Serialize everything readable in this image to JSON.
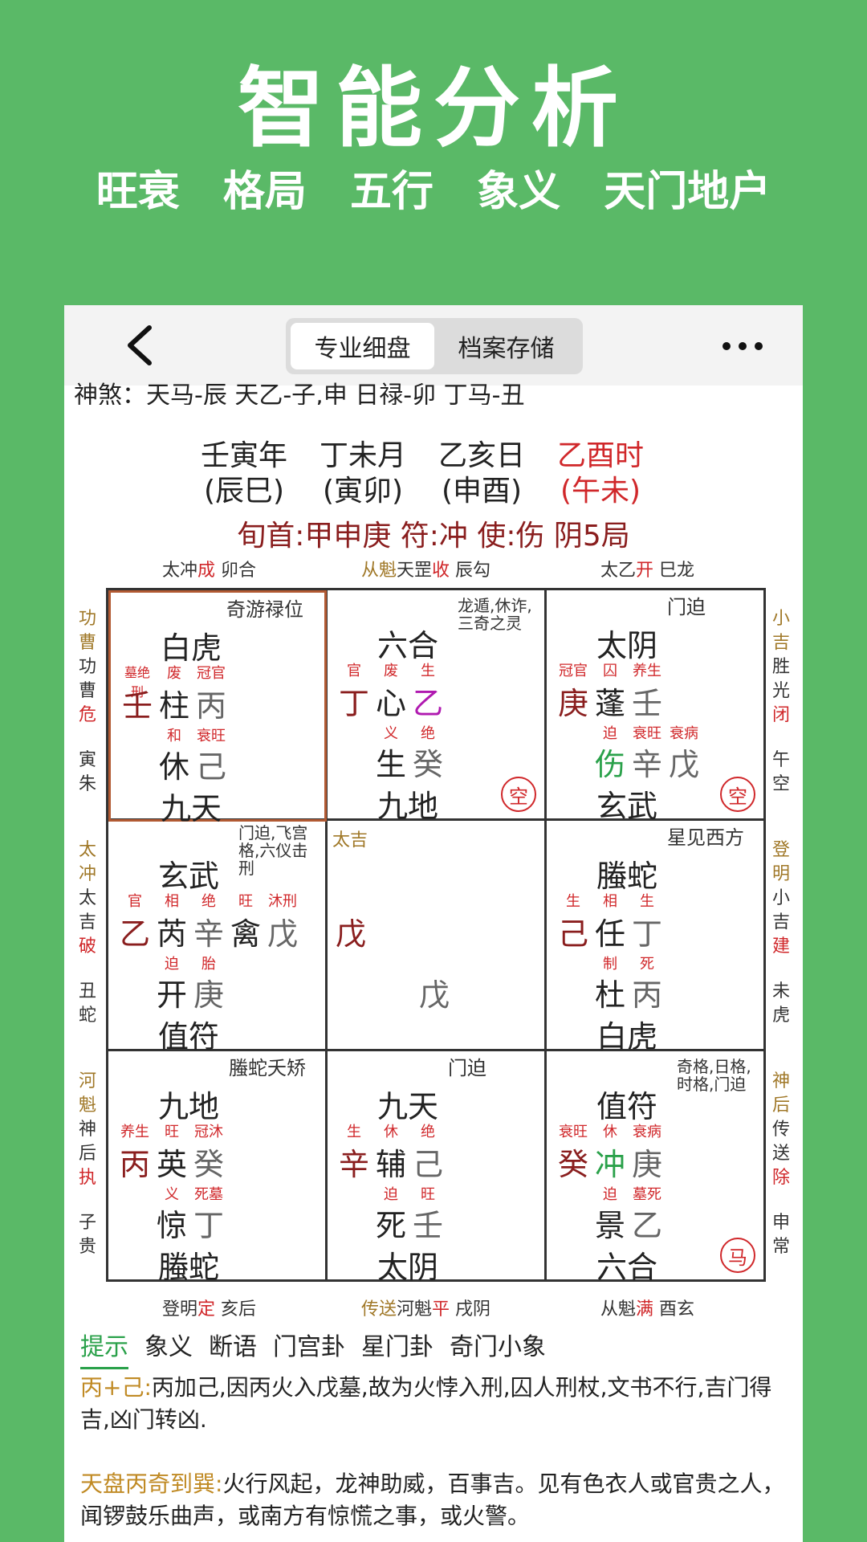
{
  "promo": {
    "title": "智能分析",
    "features": [
      "旺衰",
      "格局",
      "五行",
      "象义",
      "天门地户"
    ]
  },
  "navbar": {
    "tab_active": "专业细盘",
    "tab_other": "档案存储"
  },
  "shensha": "神煞：天马-辰 天乙-子,申 日禄-卯 丁马-丑",
  "pillars": [
    {
      "gz": "壬寅年",
      "kong": "(辰巳)"
    },
    {
      "gz": "丁未月",
      "kong": "(寅卯)"
    },
    {
      "gz": "乙亥日",
      "kong": "(申酉)"
    },
    {
      "gz": "乙酉时",
      "kong": "(午未)"
    }
  ],
  "xun": "旬首:甲申庚 符:冲 使:伤 阴5局",
  "top_edge": [
    {
      "a": "太冲",
      "b": "成",
      "c": " 卯合"
    },
    {
      "a": "从魁",
      "b": "天罡",
      "c": "收",
      "d": " 辰勾"
    },
    {
      "a": "太乙",
      "b": "开",
      "c": " 巳龙"
    }
  ],
  "bottom_edge": [
    {
      "a": "登明",
      "b": "定",
      "c": " 亥后"
    },
    {
      "a": "传送",
      "b": "河魁",
      "c": "平",
      "d": " 戌阴"
    },
    {
      "a": "从魁",
      "b": "满",
      "c": " 酉玄"
    }
  ],
  "left_side": [
    {
      "l1": "功",
      "l2": "曹",
      "l3": "功",
      "l4": "曹",
      "l5": "危",
      "l6": "寅",
      "l7": "朱"
    },
    {
      "l1": "太",
      "l2": "冲",
      "l3": "太",
      "l4": "吉",
      "l5": "破",
      "l6": "丑",
      "l7": "蛇"
    },
    {
      "l1": "河",
      "l2": "魁",
      "l3": "神",
      "l4": "后",
      "l5": "执",
      "l6": "子",
      "l7": "贵"
    }
  ],
  "right_side": [
    {
      "l1": "小",
      "l2": "吉",
      "l3": "胜",
      "l4": "光",
      "l5": "闭",
      "l6": "午",
      "l7": "空"
    },
    {
      "l1": "登",
      "l2": "明",
      "l3": "小",
      "l4": "吉",
      "l5": "建",
      "l6": "未",
      "l7": "虎"
    },
    {
      "l1": "神",
      "l2": "后",
      "l3": "传",
      "l4": "送",
      "l5": "除",
      "l6": "申",
      "l7": "常"
    }
  ],
  "palaces": {
    "p4": {
      "note": "奇游禄位",
      "god": "白虎",
      "s1": "墓绝刑",
      "s2": "废",
      "s3": "冠官",
      "c1": "壬",
      "c2": "柱",
      "c3": "丙",
      "t1": "和",
      "t2": "衰旺",
      "d1": "休",
      "d2": "己",
      "spirit": "九天"
    },
    "p9": {
      "note": "龙遁,休诈,三奇之灵",
      "god": "六合",
      "s1": "官",
      "s2": "废",
      "s3": "生",
      "c1": "丁",
      "c2": "心",
      "c3": "乙",
      "t1": "义",
      "t2": "绝",
      "d1": "生",
      "d2": "癸",
      "spirit": "九地",
      "stamp": "空"
    },
    "p2": {
      "note": "门迫",
      "god": "太阴",
      "s1": "冠官",
      "s2": "囚",
      "s3": "养生",
      "c1": "庚",
      "c2": "蓬",
      "c3": "壬",
      "t1": "迫",
      "t2": "衰旺",
      "t3": "衰病",
      "d1": "伤",
      "d2": "辛",
      "d3": "戊",
      "spirit": "玄武",
      "stamp": "空"
    },
    "p3": {
      "note": "门迫,飞宫格,六仪击刑",
      "god": "玄武",
      "s1": "官",
      "s2": "相",
      "s3": "绝",
      "s4": "旺",
      "s5": "沐刑",
      "c1": "乙",
      "c2": "芮",
      "c3": "辛",
      "c4": "禽",
      "c5": "戊",
      "t1": "迫",
      "t2": "胎",
      "d1": "开",
      "d2": "庚",
      "spirit": "值符"
    },
    "p5": {
      "note": "太吉",
      "c1": "戊",
      "d1": "戊"
    },
    "p7": {
      "note": "星见西方",
      "god": "螣蛇",
      "s1": "生",
      "s2": "相",
      "s3": "生",
      "c1": "己",
      "c2": "任",
      "c3": "丁",
      "t1": "制",
      "t2": "死",
      "d1": "杜",
      "d2": "丙",
      "spirit": "白虎"
    },
    "p8": {
      "note": "螣蛇夭矫",
      "god": "九地",
      "s1": "养生",
      "s2": "旺",
      "s3": "冠沐",
      "c1": "丙",
      "c2": "英",
      "c3": "癸",
      "t1": "义",
      "t2": "死墓",
      "d1": "惊",
      "d2": "丁",
      "spirit": "螣蛇"
    },
    "p1": {
      "note": "门迫",
      "god": "九天",
      "s1": "生",
      "s2": "休",
      "s3": "绝",
      "c1": "辛",
      "c2": "辅",
      "c3": "己",
      "t1": "迫",
      "t2": "旺",
      "d1": "死",
      "d2": "壬",
      "spirit": "太阴"
    },
    "p6": {
      "note": "奇格,日格,时格,门迫",
      "god": "值符",
      "s1": "衰旺",
      "s2": "休",
      "s3": "衰病",
      "c1": "癸",
      "c2": "冲",
      "c3": "庚",
      "t1": "迫",
      "t2": "墓死",
      "d1": "景",
      "d2": "乙",
      "spirit": "六合",
      "stamp": "马"
    }
  },
  "bottom_tabs": [
    "提示",
    "象义",
    "断语",
    "门宫卦",
    "星门卦",
    "奇门小象"
  ],
  "paragraphs": [
    {
      "key": "丙+己:",
      "text": "丙加己,因丙火入戊墓,故为火悖入刑,囚人刑杖,文书不行,吉门得吉,凶门转凶."
    },
    {
      "key": "天盘丙奇到巽:",
      "text": "火行风起，龙神助威，百事吉。见有色衣人或官贵之人，闻锣鼓乐曲声，或南方有惊慌之事，或火警。"
    }
  ]
}
